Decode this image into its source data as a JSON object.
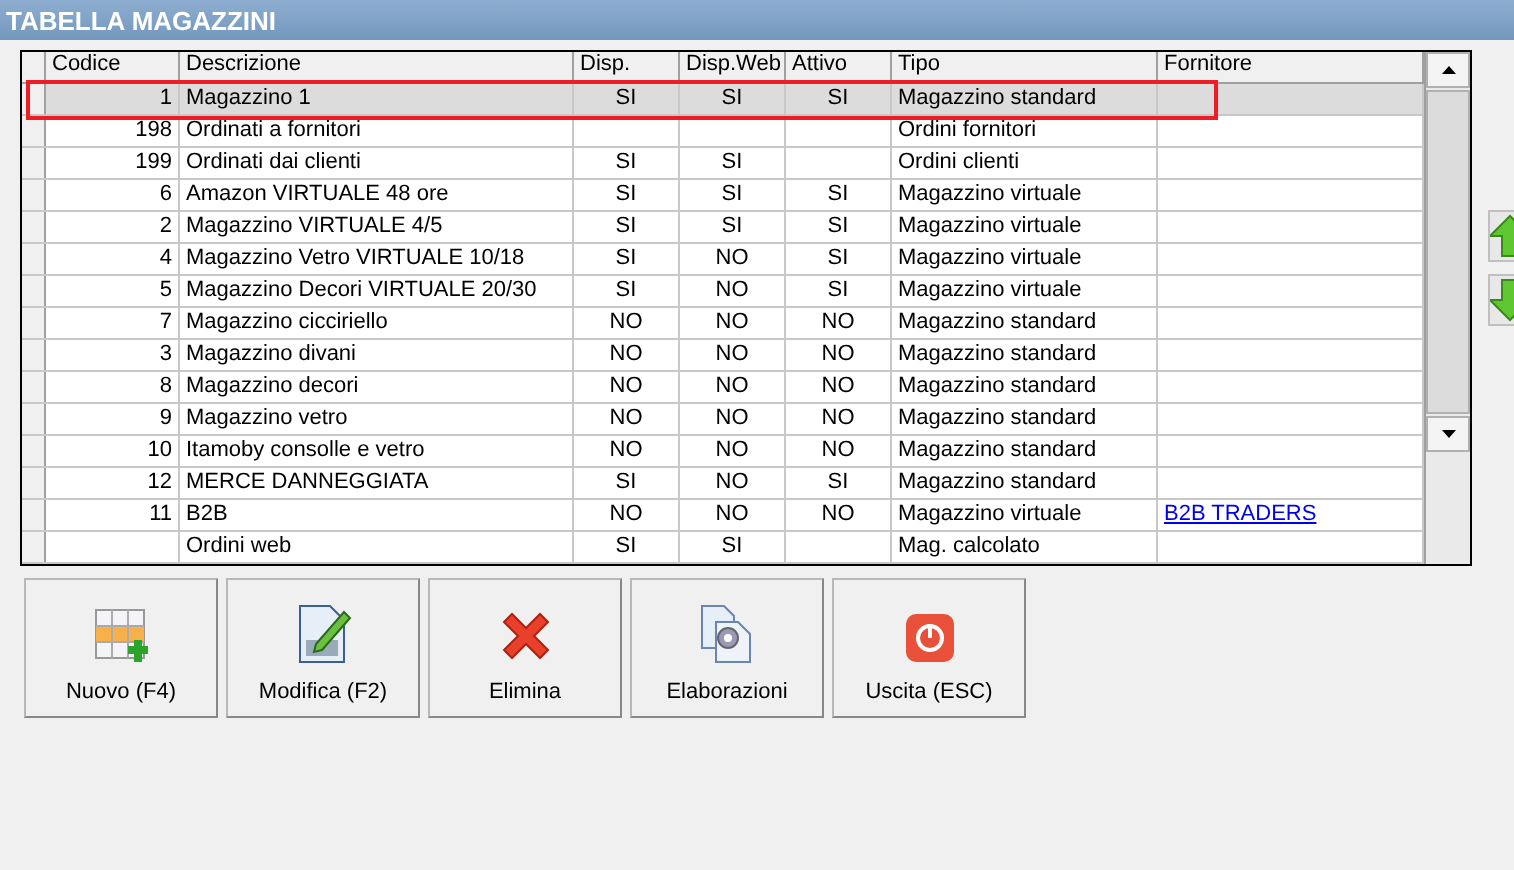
{
  "window": {
    "title": "TABELLA MAGAZZINI"
  },
  "table": {
    "columns": [
      "Codice",
      "Descrizione",
      "Disp.",
      "Disp.Web",
      "Attivo",
      "Tipo",
      "Fornitore"
    ],
    "rows": [
      {
        "selected": true,
        "cells": [
          "1",
          "Magazzino 1",
          "SI",
          "SI",
          "SI",
          "Magazzino standard",
          ""
        ]
      },
      {
        "selected": false,
        "cells": [
          "198",
          "Ordinati a fornitori",
          "",
          "",
          "",
          "Ordini fornitori",
          ""
        ]
      },
      {
        "selected": false,
        "cells": [
          "199",
          "Ordinati dai clienti",
          "SI",
          "SI",
          "",
          "Ordini clienti",
          ""
        ]
      },
      {
        "selected": false,
        "cells": [
          "6",
          "Amazon VIRTUALE 48 ore",
          "SI",
          "SI",
          "SI",
          "Magazzino virtuale",
          ""
        ]
      },
      {
        "selected": false,
        "cells": [
          "2",
          "Magazzino VIRTUALE 4/5",
          "SI",
          "SI",
          "SI",
          "Magazzino virtuale",
          ""
        ]
      },
      {
        "selected": false,
        "cells": [
          "4",
          "Magazzino Vetro VIRTUALE 10/18",
          "SI",
          "NO",
          "SI",
          "Magazzino virtuale",
          ""
        ]
      },
      {
        "selected": false,
        "cells": [
          "5",
          "Magazzino Decori VIRTUALE 20/30",
          "SI",
          "NO",
          "SI",
          "Magazzino virtuale",
          ""
        ]
      },
      {
        "selected": false,
        "cells": [
          "7",
          "Magazzino cicciriello",
          "NO",
          "NO",
          "NO",
          "Magazzino standard",
          ""
        ]
      },
      {
        "selected": false,
        "cells": [
          "3",
          "Magazzino divani",
          "NO",
          "NO",
          "NO",
          "Magazzino standard",
          ""
        ]
      },
      {
        "selected": false,
        "cells": [
          "8",
          "Magazzino decori",
          "NO",
          "NO",
          "NO",
          "Magazzino standard",
          ""
        ]
      },
      {
        "selected": false,
        "cells": [
          "9",
          "Magazzino vetro",
          "NO",
          "NO",
          "NO",
          "Magazzino standard",
          ""
        ]
      },
      {
        "selected": false,
        "cells": [
          "10",
          "Itamoby consolle e vetro",
          "NO",
          "NO",
          "NO",
          "Magazzino standard",
          ""
        ]
      },
      {
        "selected": false,
        "cells": [
          "12",
          "MERCE DANNEGGIATA",
          "SI",
          "NO",
          "SI",
          "Magazzino standard",
          ""
        ]
      },
      {
        "selected": false,
        "cells": [
          "11",
          "B2B",
          "NO",
          "NO",
          "NO",
          "Magazzino virtuale",
          "B2B TRADERS"
        ]
      },
      {
        "selected": false,
        "cells": [
          "",
          "Ordini web",
          "SI",
          "SI",
          "",
          "Mag. calcolato",
          ""
        ]
      }
    ]
  },
  "buttons": [
    {
      "kind": "new",
      "label": "Nuovo (F4)"
    },
    {
      "kind": "edit",
      "label": "Modifica (F2)"
    },
    {
      "kind": "delete",
      "label": "Elimina"
    },
    {
      "kind": "process",
      "label": "Elaborazioni"
    },
    {
      "kind": "exit",
      "label": "Uscita (ESC)"
    }
  ]
}
